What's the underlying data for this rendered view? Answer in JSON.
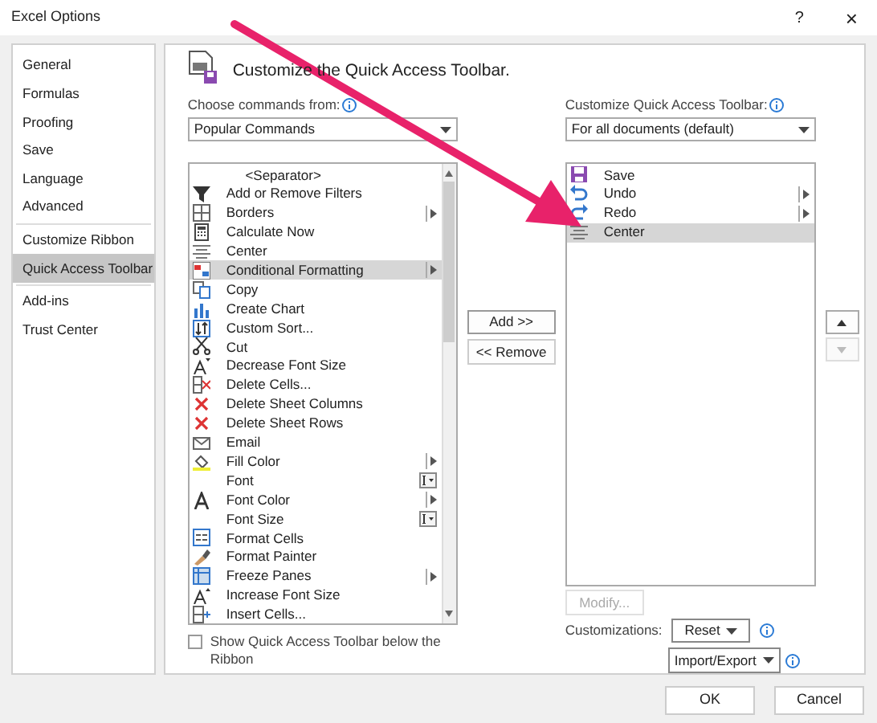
{
  "window": {
    "title": "Excel Options",
    "help": "?",
    "close": "×"
  },
  "sidebar": {
    "items": [
      {
        "label": "General",
        "selected": false,
        "divider_before": false
      },
      {
        "label": "Formulas",
        "selected": false,
        "divider_before": false
      },
      {
        "label": "Proofing",
        "selected": false,
        "divider_before": false
      },
      {
        "label": "Save",
        "selected": false,
        "divider_before": false
      },
      {
        "label": "Language",
        "selected": false,
        "divider_before": false
      },
      {
        "label": "Advanced",
        "selected": false,
        "divider_before": false
      },
      {
        "label": "Customize Ribbon",
        "selected": false,
        "divider_before": true
      },
      {
        "label": "Quick Access Toolbar",
        "selected": true,
        "divider_before": false
      },
      {
        "label": "Add-ins",
        "selected": false,
        "divider_before": true
      },
      {
        "label": "Trust Center",
        "selected": false,
        "divider_before": false
      }
    ]
  },
  "header": {
    "title": "Customize the Quick Access Toolbar."
  },
  "commands": {
    "label": "Choose commands from:",
    "dropdown": "Popular Commands",
    "items": [
      {
        "label": "<Separator>",
        "kind": "separator",
        "selected": false
      },
      {
        "label": "Add or Remove Filters",
        "kind": "command",
        "selected": false
      },
      {
        "label": "Borders",
        "kind": "submenu",
        "selected": false
      },
      {
        "label": "Calculate Now",
        "kind": "command",
        "selected": false
      },
      {
        "label": "Center",
        "kind": "command",
        "selected": false
      },
      {
        "label": "Conditional Formatting",
        "kind": "submenu",
        "selected": true
      },
      {
        "label": "Copy",
        "kind": "command",
        "selected": false
      },
      {
        "label": "Create Chart",
        "kind": "command",
        "selected": false
      },
      {
        "label": "Custom Sort...",
        "kind": "command",
        "selected": false
      },
      {
        "label": "Cut",
        "kind": "command",
        "selected": false
      },
      {
        "label": "Decrease Font Size",
        "kind": "command",
        "selected": false
      },
      {
        "label": "Delete Cells...",
        "kind": "command",
        "selected": false
      },
      {
        "label": "Delete Sheet Columns",
        "kind": "command",
        "selected": false
      },
      {
        "label": "Delete Sheet Rows",
        "kind": "command",
        "selected": false
      },
      {
        "label": "Email",
        "kind": "command",
        "selected": false
      },
      {
        "label": "Fill Color",
        "kind": "submenu",
        "selected": false
      },
      {
        "label": "Font",
        "kind": "combo",
        "selected": false
      },
      {
        "label": "Font Color",
        "kind": "submenu",
        "selected": false
      },
      {
        "label": "Font Size",
        "kind": "combo",
        "selected": false
      },
      {
        "label": "Format Cells",
        "kind": "command",
        "selected": false
      },
      {
        "label": "Format Painter",
        "kind": "command",
        "selected": false
      },
      {
        "label": "Freeze Panes",
        "kind": "submenu",
        "selected": false
      },
      {
        "label": "Increase Font Size",
        "kind": "command",
        "selected": false
      },
      {
        "label": "Insert Cells...",
        "kind": "command",
        "selected": false
      }
    ],
    "checkbox": {
      "label": "Show Quick Access Toolbar below the Ribbon",
      "checked": false
    }
  },
  "add_button": "Add >>",
  "remove_button": "<< Remove",
  "toolbar": {
    "label": "Customize Quick Access Toolbar:",
    "dropdown": "For all documents (default)",
    "items": [
      {
        "label": "Save",
        "kind": "command",
        "selected": false
      },
      {
        "label": "Undo",
        "kind": "submenu",
        "selected": false
      },
      {
        "label": "Redo",
        "kind": "submenu",
        "selected": false
      },
      {
        "label": "Center",
        "kind": "command",
        "selected": true
      }
    ],
    "move_up": {
      "disabled": false
    },
    "move_down": {
      "disabled": true
    },
    "modify": {
      "label": "Modify...",
      "disabled": true
    },
    "customizations_label": "Customizations:",
    "reset": "Reset",
    "import_export": "Import/Export"
  },
  "footer": {
    "ok": "OK",
    "cancel": "Cancel"
  }
}
